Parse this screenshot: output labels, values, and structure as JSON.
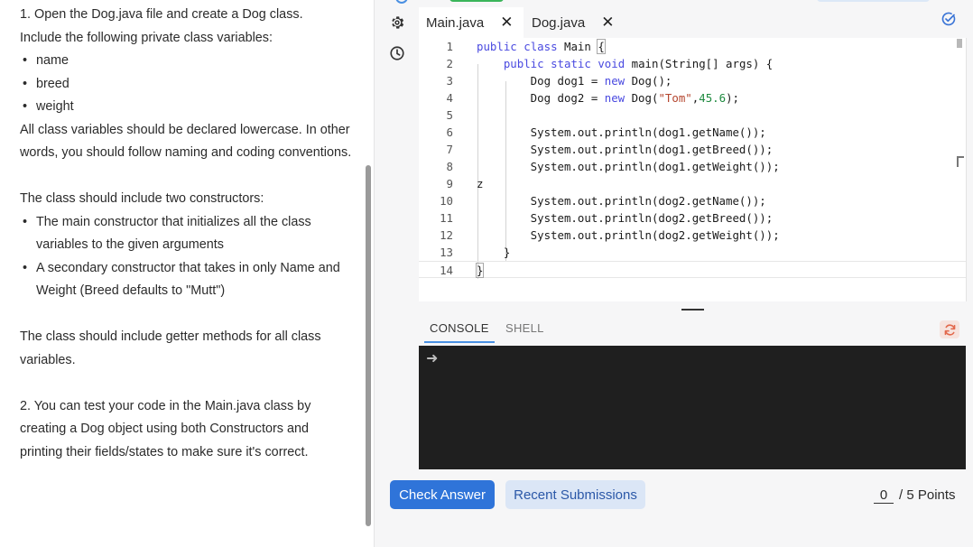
{
  "instructions": {
    "step1_intro": "1. Open the Dog.java file and create a Dog class.",
    "step1_vars_intro": "Include the following private class variables:",
    "variables": [
      "name",
      "breed",
      "weight"
    ],
    "lowercase_note": "All class variables should be declared lowercase. In other words, you should follow naming and coding conventions.",
    "constructors_intro": "The class should include two constructors:",
    "constructors": [
      "The main constructor that initializes all the class variables to the given arguments",
      "A secondary constructor that takes in only Name and Weight (Breed defaults to \"Mutt\")"
    ],
    "getters_note": "The class should include getter methods for all class variables.",
    "step2": "2. You can test your code in the Main.java class by creating a Dog object using both Constructors and printing their fields/states to make sure it's correct."
  },
  "toolbar": {
    "icons": [
      "gear-icon",
      "history-clock-icon"
    ]
  },
  "tabs": [
    {
      "label": "Main.java",
      "active": true,
      "close": "✕"
    },
    {
      "label": "Dog.java",
      "active": false,
      "close": "✕"
    }
  ],
  "editor": {
    "active_line": 14,
    "lines": [
      {
        "n": "1",
        "text": "public class Main {"
      },
      {
        "n": "2",
        "text": "    public static void main(String[] args) {"
      },
      {
        "n": "3",
        "text": "        Dog dog1 = new Dog();"
      },
      {
        "n": "4",
        "text": "        Dog dog2 = new Dog(\"Tom\",45.6);"
      },
      {
        "n": "5",
        "text": ""
      },
      {
        "n": "6",
        "text": "        System.out.println(dog1.getName());"
      },
      {
        "n": "7",
        "text": "        System.out.println(dog1.getBreed());"
      },
      {
        "n": "8",
        "text": "        System.out.println(dog1.getWeight());"
      },
      {
        "n": "9",
        "text": "z"
      },
      {
        "n": "10",
        "text": "        System.out.println(dog2.getName());"
      },
      {
        "n": "11",
        "text": "        System.out.println(dog2.getBreed());"
      },
      {
        "n": "12",
        "text": "        System.out.println(dog2.getWeight());"
      },
      {
        "n": "13",
        "text": "    }"
      },
      {
        "n": "14",
        "text": "}"
      }
    ]
  },
  "console": {
    "tabs": [
      {
        "label": "CONSOLE",
        "active": true
      },
      {
        "label": "SHELL",
        "active": false
      }
    ],
    "prompt": "➜"
  },
  "actions": {
    "check_answer": "Check Answer",
    "recent_submissions": "Recent Submissions"
  },
  "score": {
    "earned": "0",
    "total_label": "/ 5 Points"
  },
  "colors": {
    "primary_button": "#2f74d9",
    "secondary_button": "#dbe6f6",
    "console_bg": "#1f1f1f",
    "keyword": "#4a4ae0",
    "string": "#b5462f",
    "number": "#1e8a3f"
  }
}
